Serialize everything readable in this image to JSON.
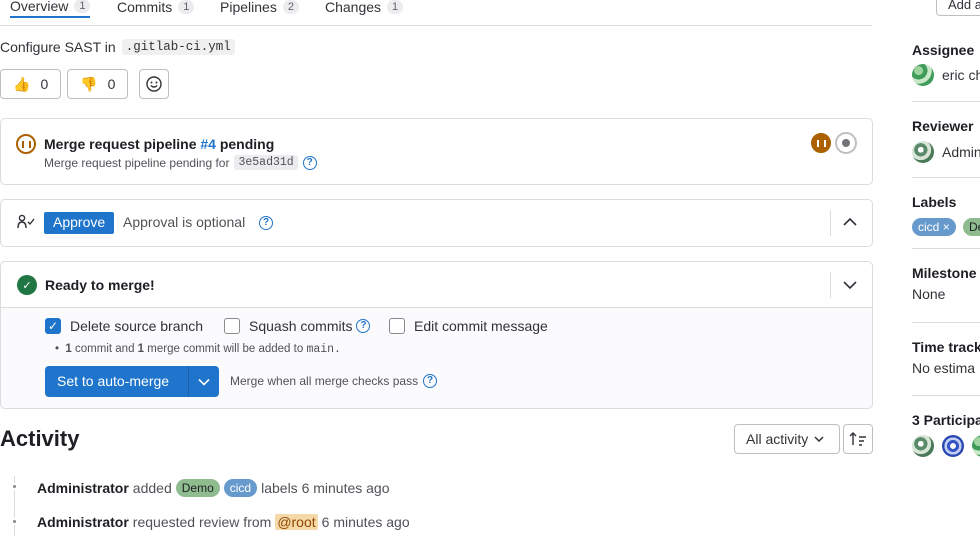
{
  "tabs": [
    {
      "label": "Overview",
      "count": "1"
    },
    {
      "label": "Commits",
      "count": "1"
    },
    {
      "label": "Pipelines",
      "count": "2"
    },
    {
      "label": "Changes",
      "count": "1"
    }
  ],
  "header": {
    "add_button": "Add a"
  },
  "description": {
    "prefix": "Configure SAST in",
    "code": ".gitlab-ci.yml"
  },
  "reactions": {
    "thumbs_up": "0",
    "thumbs_down": "0"
  },
  "pipeline": {
    "title_prefix": "Merge request pipeline",
    "link": "#4",
    "title_suffix": "pending",
    "subtitle": "Merge request pipeline pending for",
    "sha": "3e5ad31d"
  },
  "approval": {
    "button": "Approve",
    "text": "Approval is optional"
  },
  "merge": {
    "title": "Ready to merge!",
    "delete_branch": "Delete source branch",
    "squash": "Squash commits",
    "edit_message": "Edit commit message",
    "note_c1": "1",
    "note_t1": "commit and",
    "note_c2": "1",
    "note_t2": "merge commit will be added to",
    "note_branch": "main.",
    "auto_merge_button": "Set to auto-merge",
    "merge_when": "Merge when all merge checks pass"
  },
  "activity": {
    "title": "Activity",
    "filter": "All activity",
    "items": [
      {
        "actor": "Administrator",
        "action": "added",
        "label1": "Demo",
        "label2": "cicd",
        "suffix": "labels 6 minutes ago"
      },
      {
        "actor": "Administrator",
        "action": "requested review from",
        "mention": "@root",
        "suffix": "6 minutes ago"
      }
    ]
  },
  "sidebar": {
    "assignee": {
      "heading": "Assignee",
      "value": "eric ch"
    },
    "reviewer": {
      "heading": "Reviewer",
      "value": "Admin"
    },
    "labels": {
      "heading": "Labels",
      "items": [
        "cicd",
        "De"
      ]
    },
    "milestone": {
      "heading": "Milestone",
      "value": "None"
    },
    "time_tracking": {
      "heading": "Time track",
      "value": "No estima"
    },
    "participants": {
      "heading": "3 Participa"
    }
  },
  "colors": {
    "accent": "#1f75cb",
    "success": "#217645",
    "warning": "#ab6100",
    "label_demo": "#8fbc8f",
    "label_cicd": "#6699cc"
  }
}
